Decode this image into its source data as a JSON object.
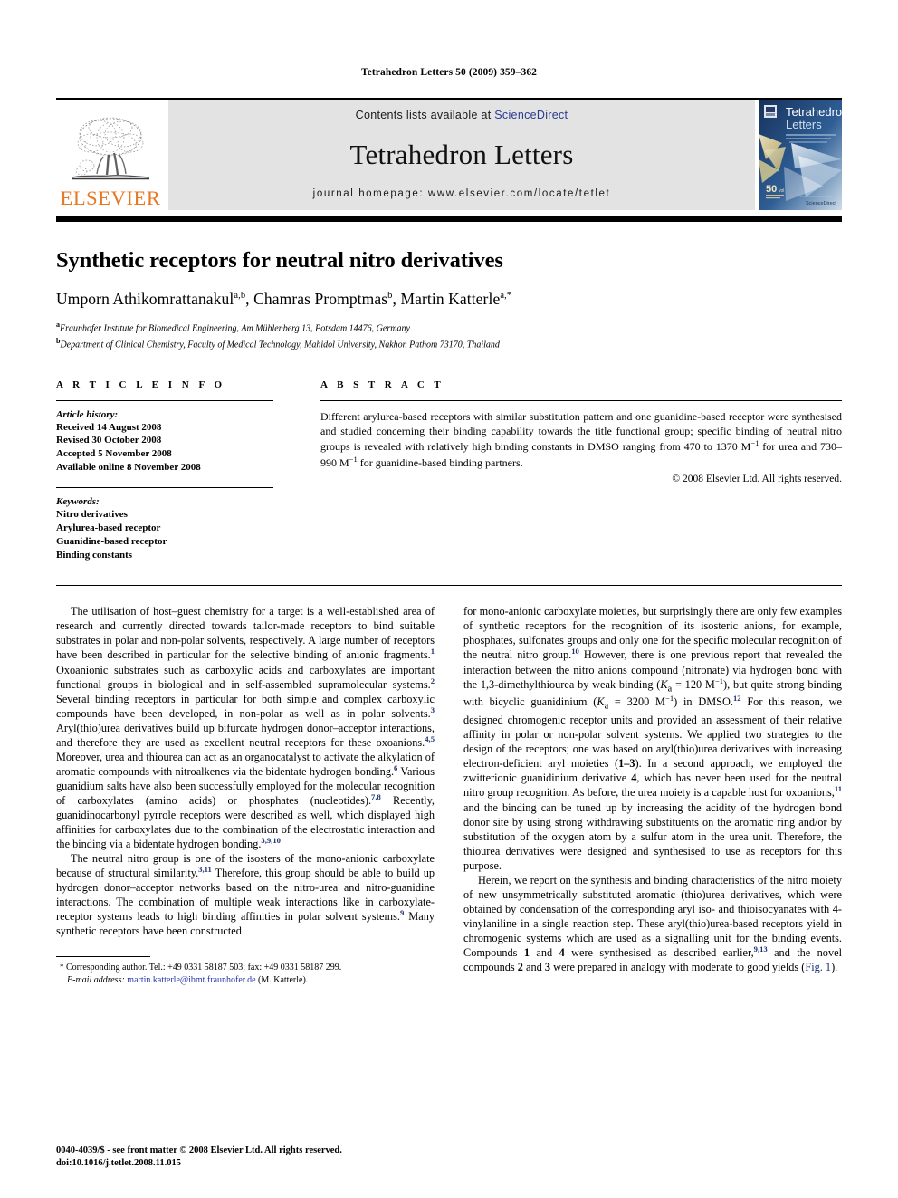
{
  "running_head": "Tetrahedron Letters 50 (2009) 359–362",
  "journal_header": {
    "publisher_name": "ELSEVIER",
    "contents_prefix": "Contents lists available at ",
    "contents_link": "ScienceDirect",
    "journal_title": "Tetrahedron Letters",
    "homepage": "journal homepage: www.elsevier.com/locate/tetlet",
    "cover": {
      "line1": "Tetrahedron",
      "line2": "Letters",
      "volume": "50",
      "badge": "ScienceDirect"
    },
    "link_color": "#2b3a8f",
    "brand_color": "#E87722"
  },
  "article": {
    "title": "Synthetic receptors for neutral nitro derivatives",
    "authors": "Umporn Athikomrattanakul a,b, Chamras Promptmas b, Martin Katterle a,*",
    "authors_parts": [
      {
        "name": "Umporn Athikomrattanakul",
        "sup": "a,b"
      },
      {
        "name": "Chamras Promptmas",
        "sup": "b"
      },
      {
        "name": "Martin Katterle",
        "sup": "a,*"
      }
    ],
    "affiliations": [
      {
        "marker": "a",
        "text": "Fraunhofer Institute for Biomedical Engineering, Am Mühlenberg 13, Potsdam 14476, Germany"
      },
      {
        "marker": "b",
        "text": "Department of Clinical Chemistry, Faculty of Medical Technology, Mahidol University, Nakhon Pathom 73170, Thailand"
      }
    ]
  },
  "article_info": {
    "heading": "A R T I C L E    I N F O",
    "history_label": "Article history:",
    "history": [
      "Received 14 August 2008",
      "Revised 30 October 2008",
      "Accepted 5 November 2008",
      "Available online 8 November 2008"
    ],
    "keywords_label": "Keywords:",
    "keywords": [
      "Nitro derivatives",
      "Arylurea-based receptor",
      "Guanidine-based receptor",
      "Binding constants"
    ]
  },
  "abstract": {
    "heading": "A B S T R A C T",
    "text_part1": "Different arylurea-based receptors with similar substitution pattern and one guanidine-based receptor were synthesised and studied concerning their binding capability towards the title functional group; specific binding of neutral nitro groups is revealed with relatively high binding constants in DMSO ranging from 470 to 1370 M",
    "sup1": "−1",
    "text_part2": " for urea and 730–990 M",
    "sup2": "−1",
    "text_part3": " for guanidine-based binding partners.",
    "copyright": "© 2008 Elsevier Ltd. All rights reserved."
  },
  "body": {
    "left": {
      "p1_a": "The utilisation of host–guest chemistry for a target is a well-established area of research and currently directed towards tailor-made receptors to bind suitable substrates in polar and non-polar solvents, respectively. A large number of receptors have been described in particular for the selective binding of anionic fragments.",
      "r1": "1",
      "p1_b": " Oxoanionic substrates such as carboxylic acids and carboxylates are important functional groups in biological and in self-assembled supramolecular systems.",
      "r2": "2",
      "p1_c": " Several binding receptors in particular for both simple and complex carboxylic compounds have been developed, in non-polar as well as in polar solvents.",
      "r3": "3",
      "p1_d": " Aryl(thio)urea derivatives build up bifurcate hydrogen donor–acceptor interactions, and therefore they are used as excellent neutral receptors for these oxoanions.",
      "r4": "4,5",
      "p1_e": " Moreover, urea and thiourea can act as an organocatalyst to activate the alkylation of aromatic compounds with nitroalkenes via the bidentate hydrogen bonding.",
      "r5": "6",
      "p1_f": " Various guanidium salts have also been successfully employed for the molecular recognition of carboxylates (amino acids) or phosphates (nucleotides).",
      "r6": "7,8",
      "p1_g": " Recently, guanidinocarbonyl pyrrole receptors were described as well, which displayed high affinities for carboxylates due to the combination of the electrostatic interaction and the binding via a bidentate hydrogen bonding.",
      "r7": "3,9,10",
      "p2_a": "The neutral nitro group is one of the isosters of the mono-anionic carboxylate because of structural similarity.",
      "r8": "3,11",
      "p2_b": " Therefore, this group should be able to build up hydrogen donor–acceptor networks based on the nitro-urea and nitro-guanidine interactions. The combination of multiple weak interactions like in carboxylate-receptor systems leads to high binding affinities in polar solvent systems.",
      "r9": "9",
      "p2_c": " Many synthetic receptors have been constructed"
    },
    "right": {
      "p1_a": "for mono-anionic carboxylate moieties, but surprisingly there are only few examples of synthetic receptors for the recognition of its isosteric anions, for example, phosphates, sulfonates groups and only one for the specific molecular recognition of the neutral nitro group.",
      "r10": "10",
      "p1_b": " However, there is one previous report that revealed the interaction between the nitro anions compound (nitronate) via hydrogen bond with the 1,3-dimethylthiourea by weak binding (",
      "ka1": "K",
      "ka1sub": "a",
      "ka1val": " = 120 M",
      "ka1sup": "−1",
      "p1_c": "), but quite strong binding with bicyclic guanidinium (",
      "ka2": "K",
      "ka2sub": "a",
      "ka2val": " = 3200 M",
      "ka2sup": "−1",
      "p1_d": ") in DMSO.",
      "r12": "12",
      "p1_e": " For this reason, we designed chromogenic receptor units and provided an assessment of their relative affinity in polar or non-polar solvent systems. We applied two strategies to the design of the receptors; one was based on aryl(thio)urea derivatives with increasing electron-deficient aryl moieties (",
      "cmp13": "1–3",
      "p1_f": "). In a second approach, we employed the zwitterionic guanidinium derivative ",
      "cmp4": "4",
      "p1_g": ", which has never been used for the neutral nitro group recognition. As before, the urea moiety is a capable host for oxoanions,",
      "r11": "11",
      "p1_h": " and the binding can be tuned up by increasing the acidity of the hydrogen bond donor site by using strong withdrawing substituents on the aromatic ring and/or by substitution of the oxygen atom by a sulfur atom in the urea unit. Therefore, the thiourea derivatives were designed and synthesised to use as receptors for this purpose.",
      "p2_a": "Herein, we report on the synthesis and binding characteristics of the nitro moiety of new unsymmetrically substituted aromatic (thio)urea derivatives, which were obtained by condensation of the corresponding aryl iso- and thioisocyanates with 4-vinylaniline in a single reaction step. These aryl(thio)urea-based receptors yield in chromogenic systems which are used as a signalling unit for the binding events. Compounds ",
      "cmp1": "1",
      "p2_b": " and ",
      "cmp4b": "4",
      "p2_c": " were synthesised as described earlier,",
      "r913": "9,13",
      "p2_d": " and the novel compounds ",
      "cmp2": "2",
      "p2_e": " and ",
      "cmp3": "3",
      "p2_f": " were prepared in analogy with moderate to good yields (",
      "figref": "Fig. 1",
      "p2_g": ")."
    }
  },
  "footnote": {
    "star": "*",
    "text_a": "Corresponding author. Tel.: +49 0331 58187 503; fax: +49 0331 58187 299.",
    "email_label": "E-mail address:",
    "email": "martin.katterle@ibmt.fraunhofer.de",
    "email_suffix": "(M. Katterle)."
  },
  "page_footer": {
    "line1": "0040-4039/$ - see front matter © 2008 Elsevier Ltd. All rights reserved.",
    "line2": "doi:10.1016/j.tetlet.2008.11.015"
  }
}
